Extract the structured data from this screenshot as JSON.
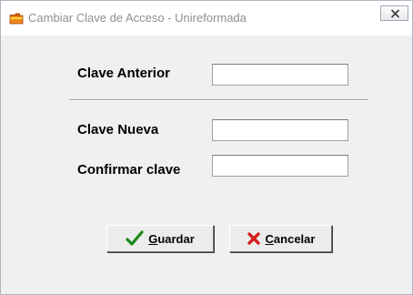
{
  "window": {
    "title": "Cambiar Clave de Acceso - Unireformada",
    "app_icon": "folder-icon",
    "close_icon": "close-icon"
  },
  "form": {
    "old_password_label": "Clave Anterior",
    "old_password_value": "",
    "new_password_label": "Clave Nueva",
    "new_password_value": "",
    "confirm_password_label": "Confirmar clave",
    "confirm_password_value": ""
  },
  "buttons": {
    "save": {
      "mnemonic": "G",
      "rest": "uardar",
      "icon": "checkmark-icon",
      "icon_color": "#1a8a1a"
    },
    "cancel": {
      "mnemonic": "C",
      "rest": "ancelar",
      "icon": "x-icon",
      "icon_color": "#d42020"
    }
  }
}
